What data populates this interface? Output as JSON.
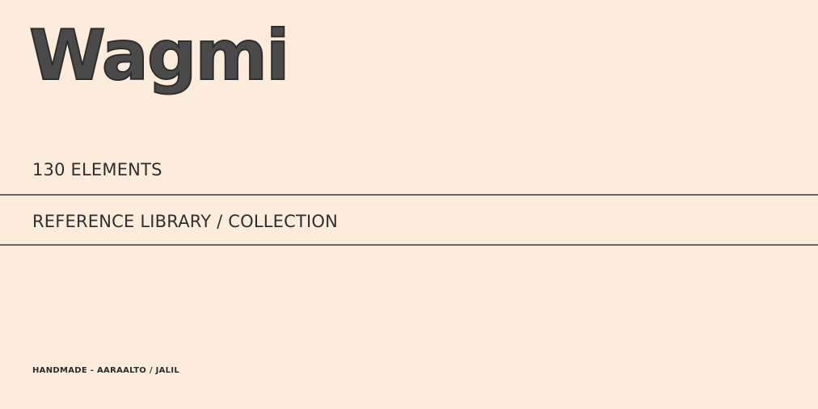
{
  "card": {
    "title": "Wagmi",
    "count": "130 ELEMENTS",
    "subtitle": "REFERENCE LIBRARY / COLLECTION",
    "credit": "HANDMADE - AARAALTO / JALIL"
  },
  "colors": {
    "background": "#fdecdc",
    "ink": "#2b2b2b"
  }
}
